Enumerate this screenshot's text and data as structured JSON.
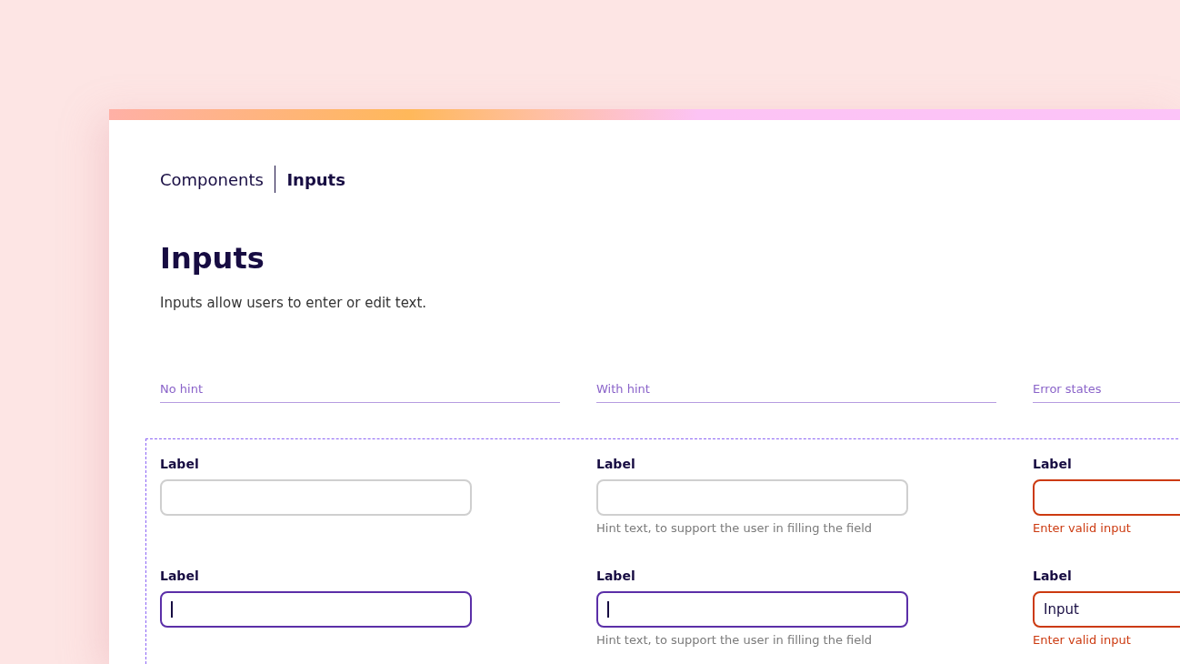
{
  "breadcrumb": {
    "parent": "Components",
    "current": "Inputs"
  },
  "title": "Inputs",
  "description": "Inputs allow users to enter or edit text.",
  "columns": [
    {
      "heading": "No hint",
      "fields": [
        {
          "label": "Label",
          "focused": false,
          "error": false
        },
        {
          "label": "Label",
          "focused": true,
          "error": false
        }
      ]
    },
    {
      "heading": "With hint",
      "fields": [
        {
          "label": "Label",
          "focused": false,
          "error": false,
          "hint": "Hint text, to support the user in filling the field"
        },
        {
          "label": "Label",
          "focused": true,
          "error": false,
          "hint": "Hint text, to support the user in filling the field"
        }
      ]
    },
    {
      "heading": "Error states",
      "fields": [
        {
          "label": "Label",
          "focused": false,
          "error": true,
          "hint": "Enter valid input"
        },
        {
          "label": "Label",
          "focused": false,
          "error": true,
          "value": "Input",
          "hint": "Enter valid input"
        }
      ]
    }
  ]
}
